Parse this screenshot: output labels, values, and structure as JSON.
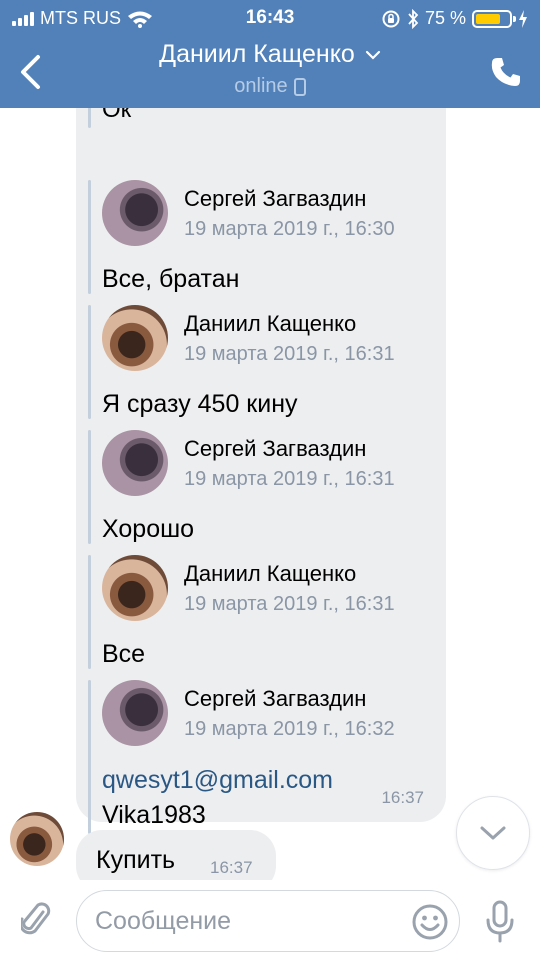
{
  "status_bar": {
    "carrier": "MTS RUS",
    "time": "16:43",
    "battery_percent": "75 %",
    "battery_level": 0.75,
    "icons": [
      "signal-icon",
      "wifi-icon",
      "orientation-lock-icon",
      "bluetooth-icon",
      "battery-icon",
      "charging-icon"
    ]
  },
  "header": {
    "title": "Даниил Кащенко",
    "status": "online",
    "icons": [
      "back-icon",
      "chevron-down-icon",
      "phone-icon",
      "mobile-icon"
    ]
  },
  "forwarded": {
    "top_text": "Ок",
    "messages": [
      {
        "author": "Сергей Загваздин",
        "date": "19 марта 2019 г., 16:30",
        "text": "Все, братан"
      },
      {
        "author": "Даниил Кащенко",
        "date": "19 марта 2019 г., 16:31",
        "text": "Я сразу 450 кину"
      },
      {
        "author": "Сергей Загваздин",
        "date": "19 марта 2019 г., 16:31",
        "text": "Хорошо"
      },
      {
        "author": "Даниил Кащенко",
        "date": "19 марта 2019 г., 16:31",
        "text": "Все"
      },
      {
        "author": "Сергей Загваздин",
        "date": "19 марта 2019 г., 16:32",
        "link": "qwesyt1@gmail.com",
        "text": "Vika1983"
      }
    ],
    "time": "16:37"
  },
  "last_message": {
    "text": "Купить",
    "time": "16:37"
  },
  "input": {
    "placeholder": "Сообщение",
    "value": ""
  },
  "colors": {
    "header_bg": "#5181b8",
    "bubble_bg": "#edeef0",
    "link": "#2a5885",
    "meta": "#8a96a6"
  }
}
